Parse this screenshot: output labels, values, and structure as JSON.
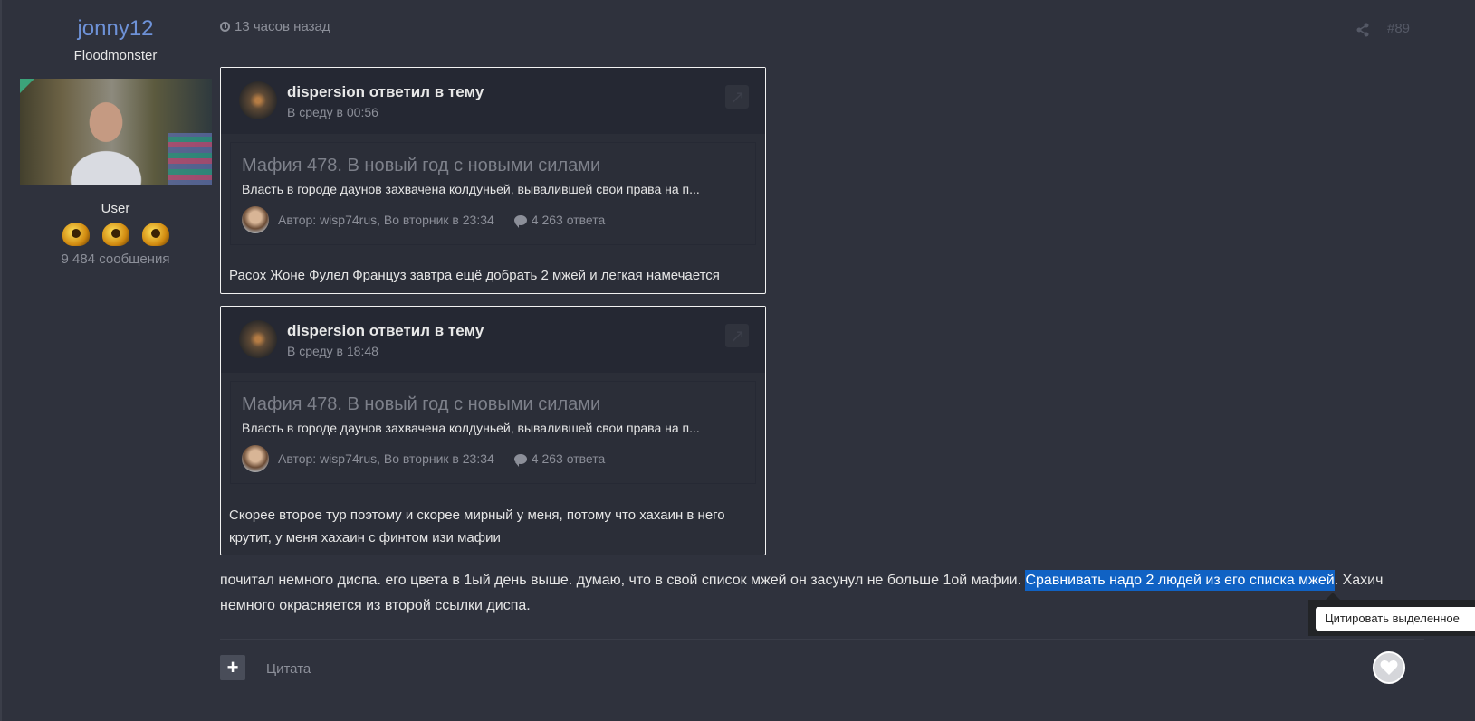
{
  "author": {
    "name": "jonny12",
    "title": "Floodmonster",
    "group": "User",
    "posts_count": "9 484 сообщения"
  },
  "post": {
    "time": "13 часов назад",
    "number": "#89",
    "text_before": "почитал немного диспа. его цвета в 1ый день выше. думаю, что в свой список мжей он засунул не больше 1ой мафии. ",
    "text_selected": "Сравнивать надо 2 людей из его списка мжей",
    "text_after": ". Хахич немного окрасняется из второй ссылки диспа."
  },
  "activities": [
    {
      "user": "dispersion",
      "action": "ответил в тему",
      "time": "В среду в 00:56",
      "topic_title": "Мафия 478. В новый год с новыми силами",
      "topic_excerpt": "Власть в городе даунов захвачена колдуньей, вывалившей свои права на п...",
      "topic_author": "Автор: wisp74rus, Во вторник в 23:34",
      "topic_replies": "4 263 ответа",
      "reply_text": "Расох Жоне Фулел Француз завтра ещё добрать 2 мжей и легкая намечается"
    },
    {
      "user": "dispersion",
      "action": "ответил в тему",
      "time": "В среду в 18:48",
      "topic_title": "Мафия 478. В новый год с новыми силами",
      "topic_excerpt": "Власть в городе даунов захвачена колдуньей, вывалившей свои права на п...",
      "topic_author": "Автор: wisp74rus, Во вторник в 23:34",
      "topic_replies": "4 263 ответа",
      "reply_text": "Скорее второе   тур поэтому и скорее мирный у меня, потому что хахаин в него крутит, у меня хахаин с финтом изи мафии"
    }
  ],
  "tooltip": {
    "label": "Цитировать выделенное"
  },
  "controls": {
    "quote_label": "Цитата",
    "plus_label": "+"
  }
}
